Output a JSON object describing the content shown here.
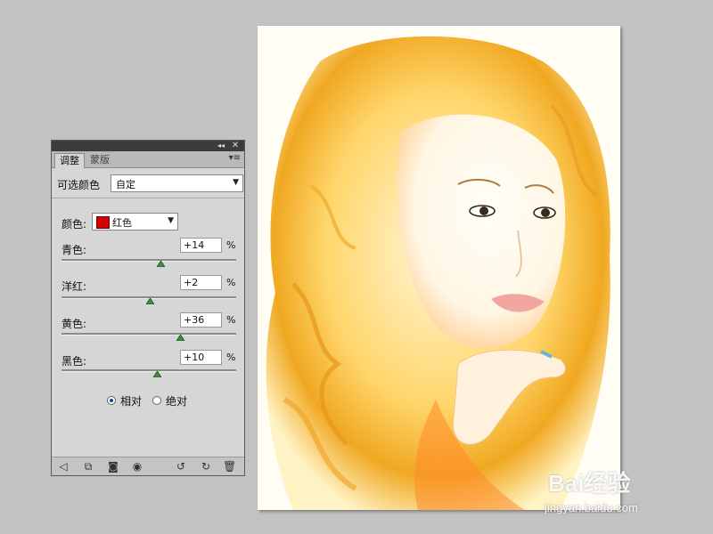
{
  "panel": {
    "tabs": [
      {
        "label": "调整",
        "active": true
      },
      {
        "label": "蒙版",
        "active": false
      }
    ],
    "adjustment_name": "可选颜色",
    "preset": "自定",
    "colors_label": "颜色:",
    "selected_color": "红色",
    "selected_color_swatch": "#d40000",
    "sliders": [
      {
        "label": "青色:",
        "value": "+14",
        "unit": "%",
        "fraction": 0.57
      },
      {
        "label": "洋红:",
        "value": "+2",
        "unit": "%",
        "fraction": 0.51
      },
      {
        "label": "黄色:",
        "value": "+36",
        "unit": "%",
        "fraction": 0.68
      },
      {
        "label": "黑色:",
        "value": "+10",
        "unit": "%",
        "fraction": 0.55
      }
    ],
    "method": [
      {
        "label": "相对",
        "selected": true
      },
      {
        "label": "绝对",
        "selected": false
      }
    ],
    "bottom_icons": [
      "back-arrow-icon",
      "clip-layer-icon",
      "visibility-toggle-icon",
      "eye-icon",
      "prev-state-icon",
      "reset-icon",
      "trash-icon"
    ]
  },
  "watermark": {
    "logo": "Bai经验",
    "url": "jingyan.baidu.com"
  }
}
